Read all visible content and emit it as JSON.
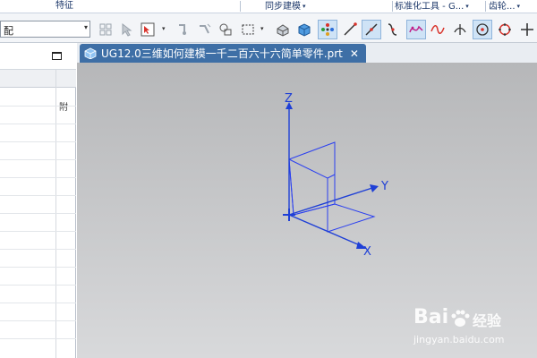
{
  "ribbon": {
    "groups": [
      {
        "label": "特征",
        "arrow": ""
      },
      {
        "label": "同步建模",
        "arrow": "▾"
      },
      {
        "label": "标准化工具 - G...",
        "arrow": "▾"
      },
      {
        "label": "齿轮...",
        "arrow": "▾"
      }
    ]
  },
  "toolbar": {
    "filter_value": "配",
    "dropdown_glyph": "▾"
  },
  "resource_panel": {
    "column2_header": "附"
  },
  "document_tab": {
    "title": "UG12.0三维如何建模一千二百六十六简单零件.prt",
    "close_glyph": "✕"
  },
  "viewport": {
    "axes": {
      "z": "Z",
      "y": "Y",
      "x": "X"
    },
    "colors": {
      "wcs": "#1e3fd6",
      "sketch": "#2a3ff0",
      "active_tab": "#3e6fa6"
    }
  },
  "watermark": {
    "brand": "Bai",
    "brand_suffix": "经验",
    "url": "jingyan.baidu.com"
  }
}
